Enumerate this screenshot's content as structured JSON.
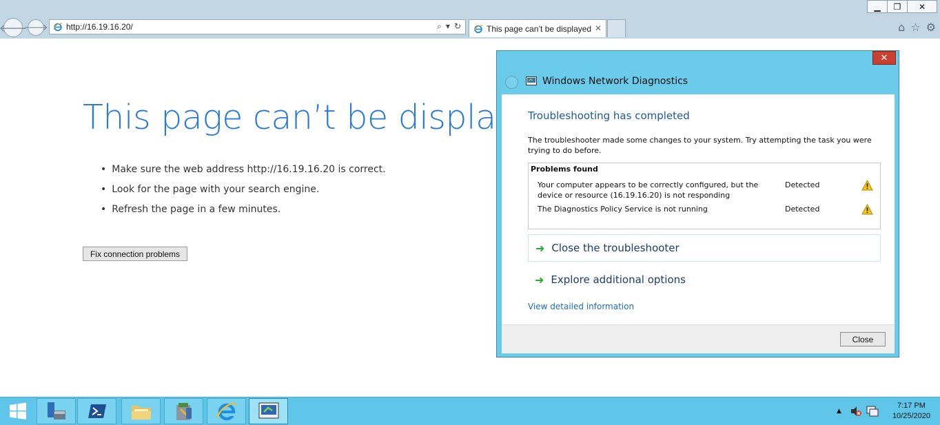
{
  "browser": {
    "address": "http://16.19.16.20/",
    "tab_title": "This page can’t be displayed",
    "tab_close_glyph": "✕",
    "window_controls": {
      "minimize": "▁",
      "restore": "❐",
      "close": "✕"
    }
  },
  "error_page": {
    "title": "This page can’t be displayed",
    "tips": [
      "Make sure the web address http://16.19.16.20 is correct.",
      "Look for the page with your search engine.",
      "Refresh the page in a few minutes."
    ],
    "fix_button_label": "Fix connection problems"
  },
  "diagnostics": {
    "window_title": "Windows Network Diagnostics",
    "heading": "Troubleshooting has completed",
    "message": "The troubleshooter made some changes to your system. Try attempting the task you were trying to do before.",
    "problems_header": "Problems found",
    "problems": [
      {
        "text": "Your computer appears to be correctly configured, but the device or resource (16.19.16.20) is not responding",
        "status": "Detected"
      },
      {
        "text": "The Diagnostics Policy Service is not running",
        "status": "Detected"
      }
    ],
    "close_troubleshooter": "Close the troubleshooter",
    "explore_options": "Explore additional options",
    "view_details": "View detailed information",
    "close_button": "Close",
    "close_x": "✕"
  },
  "taskbar": {
    "time": "7:17 PM",
    "date": "10/25/2020",
    "items": [
      "server-manager-icon",
      "powershell-icon",
      "file-explorer-icon",
      "admin-tools-icon",
      "internet-explorer-icon",
      "network-diagnostics-icon"
    ]
  },
  "colors": {
    "title_blue": "#2b7bd6",
    "window_accent": "#6acbea",
    "taskbar": "#5fc6ea",
    "link_green": "#2fa83b"
  }
}
